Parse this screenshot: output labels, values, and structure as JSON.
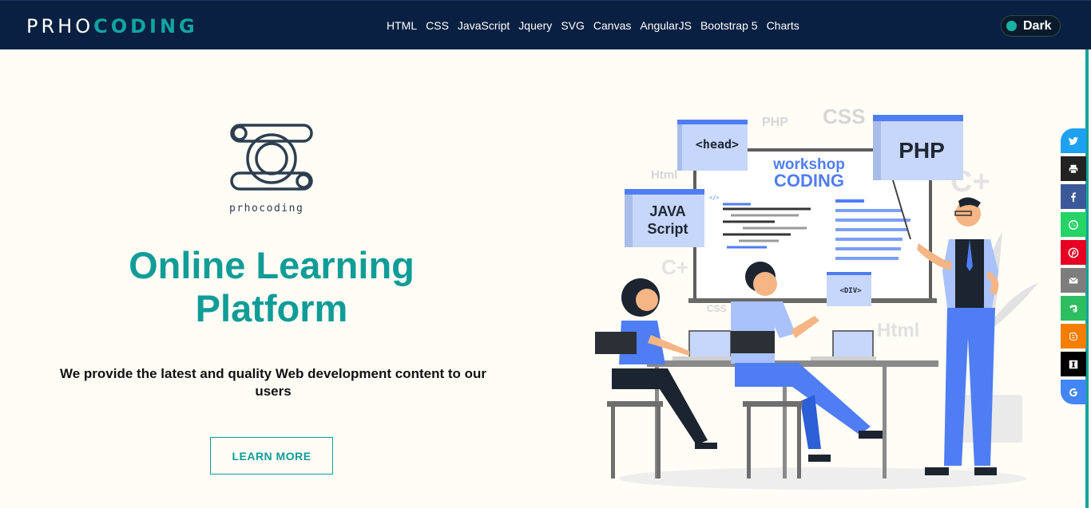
{
  "brand": {
    "part1": "PRHO",
    "part2": "CODING"
  },
  "nav": {
    "items": [
      "HTML",
      "CSS",
      "JavaScript",
      "Jquery",
      "SVG",
      "Canvas",
      "AngularJS",
      "Bootstrap 5",
      "Charts"
    ]
  },
  "theme_toggle": {
    "label": "Dark"
  },
  "hero": {
    "logo_text": "prhocoding",
    "headline_line1": "Online Learning",
    "headline_line2": "Platform",
    "subtext": "We provide the latest and quality Web development content to our users",
    "button_label": "LEARN MORE"
  },
  "illustration": {
    "board_title_1": "workshop",
    "board_title_2": "CODING",
    "card_head": "<head>",
    "card_php": "PHP",
    "card_js_1": "JAVA",
    "card_js_2": "Script",
    "card_div": "<DIV>",
    "bg_php": "PHP",
    "bg_css": "CSS",
    "bg_html_1": "Html",
    "bg_cplus_1": "C+",
    "bg_cplus_2": "C+",
    "bg_css_2": "CSS",
    "bg_html_2": "Html",
    "code_tag": "</>"
  },
  "share": {
    "buttons": [
      {
        "name": "twitter",
        "icon": "twitter-icon",
        "color": "#1da1f2"
      },
      {
        "name": "print",
        "icon": "print-icon",
        "color": "#222222"
      },
      {
        "name": "facebook",
        "icon": "facebook-icon",
        "color": "#3b5998"
      },
      {
        "name": "whatsapp",
        "icon": "whatsapp-icon",
        "color": "#25d366"
      },
      {
        "name": "pinterest",
        "icon": "pinterest-icon",
        "color": "#e60023"
      },
      {
        "name": "email",
        "icon": "email-icon",
        "color": "#7d7d7d"
      },
      {
        "name": "evernote",
        "icon": "evernote-icon",
        "color": "#2dbe60"
      },
      {
        "name": "blogger",
        "icon": "blogger-icon",
        "color": "#f57d00"
      },
      {
        "name": "instapaper",
        "icon": "instapaper-icon",
        "color": "#000000"
      },
      {
        "name": "google",
        "icon": "google-icon",
        "color": "#4285f4"
      }
    ]
  },
  "colors": {
    "nav_bg": "#0a2042",
    "accent": "#10a5a2",
    "page_bg": "#fffdf6",
    "illustration_blue": "#4f7df4"
  }
}
